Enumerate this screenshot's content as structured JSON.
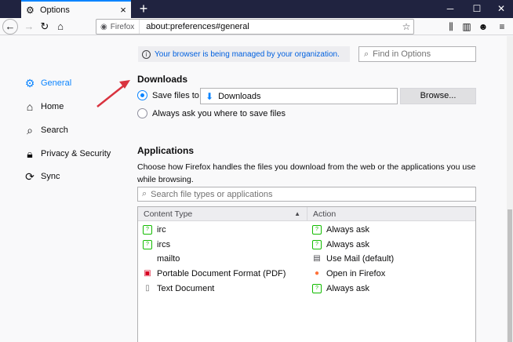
{
  "tab": {
    "title": "Options",
    "icon": "gear-icon"
  },
  "window": {
    "new_tab": "+",
    "minimize": "─",
    "maximize": "☐",
    "close": "✕"
  },
  "nav": {
    "identity_label": "Firefox",
    "url": "about:preferences#general"
  },
  "policy_notice": "Your browser is being managed by your organization.",
  "search": {
    "placeholder": "Find in Options"
  },
  "sidebar": {
    "items": [
      {
        "label": "General",
        "icon": "gear-icon",
        "selected": true
      },
      {
        "label": "Home",
        "icon": "home-icon",
        "selected": false
      },
      {
        "label": "Search",
        "icon": "search-icon",
        "selected": false
      },
      {
        "label": "Privacy & Security",
        "icon": "lock-icon",
        "selected": false
      },
      {
        "label": "Sync",
        "icon": "sync-icon",
        "selected": false
      }
    ]
  },
  "downloads": {
    "heading": "Downloads",
    "save_label": "Save files to",
    "folder": "Downloads",
    "browse_label": "Browse...",
    "ask_label": "Always ask you where to save files"
  },
  "applications": {
    "heading": "Applications",
    "description": "Choose how Firefox handles the files you download from the web or the applications you use while browsing.",
    "search_placeholder": "Search file types or applications",
    "columns": [
      "Content Type",
      "Action"
    ],
    "rows": [
      {
        "type": "irc",
        "type_icon": "ask-icon",
        "action": "Always ask",
        "action_icon": "ask-icon"
      },
      {
        "type": "ircs",
        "type_icon": "ask-icon",
        "action": "Always ask",
        "action_icon": "ask-icon"
      },
      {
        "type": "mailto",
        "type_icon": "",
        "action": "Use Mail (default)",
        "action_icon": "mail-icon"
      },
      {
        "type": "Portable Document Format (PDF)",
        "type_icon": "pdf-icon",
        "action": "Open in Firefox",
        "action_icon": "firefox-icon"
      },
      {
        "type": "Text Document",
        "type_icon": "document-icon",
        "action": "Always ask",
        "action_icon": "ask-icon"
      }
    ]
  },
  "colors": {
    "accent": "#0a84ff",
    "titlebar": "#202340",
    "annotation_arrow": "#d9333f"
  }
}
